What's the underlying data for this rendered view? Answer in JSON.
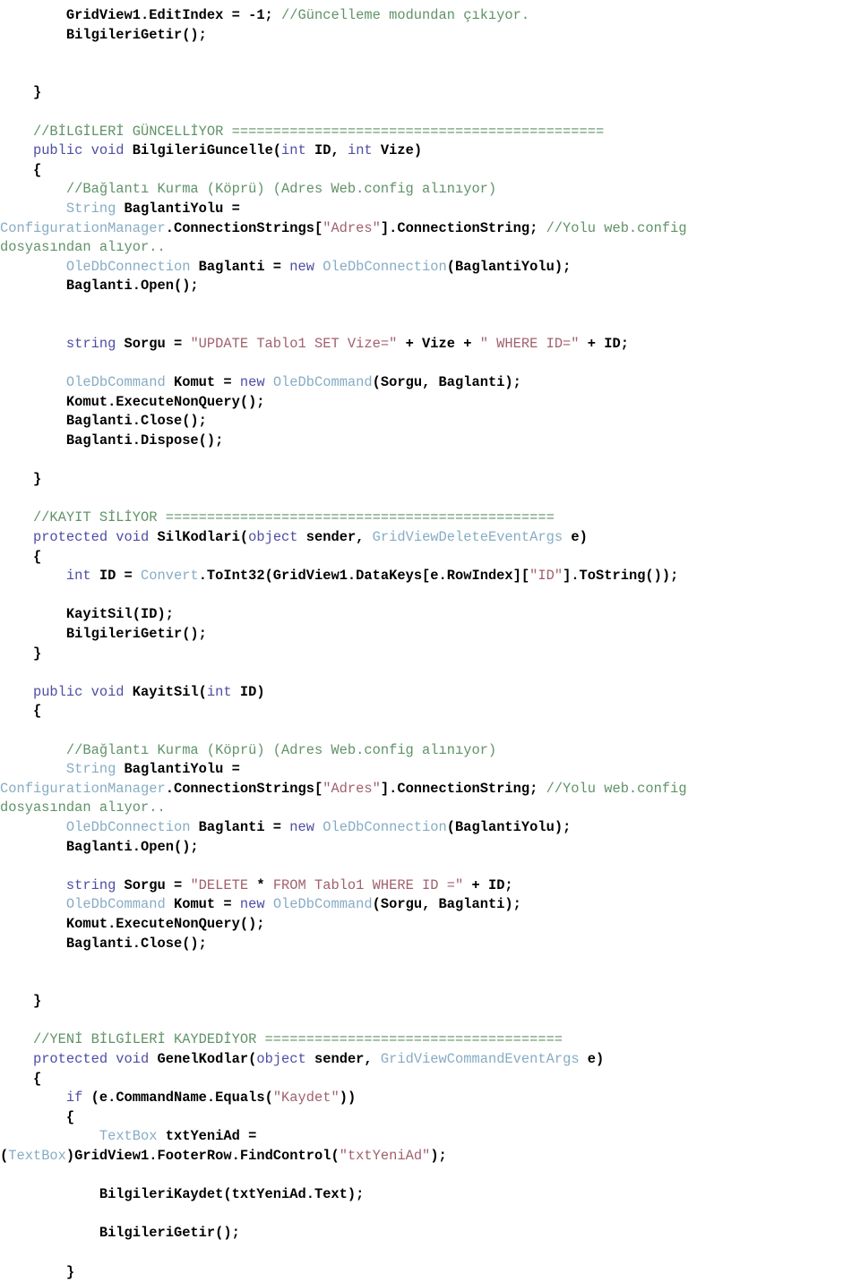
{
  "document": {
    "title": "C# ASP.NET GridView Kodlari",
    "language": "csharp",
    "background_color": "#ffffff"
  },
  "theme": {
    "plain": "#000000",
    "comment": "#5f9367",
    "keyword": "#4d4da6",
    "type": "#86acc4",
    "string": "#a1606d",
    "operator": "#000000"
  },
  "code": {
    "lines": [
      {
        "id": "l1",
        "tokens": [
          {
            "t": "        ",
            "c": "plain"
          },
          {
            "t": "GridView1.EditIndex = -1; ",
            "c": "plain"
          },
          {
            "t": "//Güncelleme modundan çıkıyor.",
            "c": "comment"
          }
        ]
      },
      {
        "id": "l2",
        "tokens": [
          {
            "t": "        BilgileriGetir();",
            "c": "plain"
          }
        ]
      },
      {
        "id": "l3",
        "tokens": []
      },
      {
        "id": "l4",
        "tokens": []
      },
      {
        "id": "l5",
        "tokens": [
          {
            "t": "    }",
            "c": "plain"
          }
        ]
      },
      {
        "id": "l6",
        "tokens": []
      },
      {
        "id": "l7",
        "tokens": [
          {
            "t": "    //BİLGİLERİ GÜNCELLİYOR =============================================",
            "c": "comment"
          }
        ]
      },
      {
        "id": "l8",
        "tokens": [
          {
            "t": "    ",
            "c": "plain"
          },
          {
            "t": "public void ",
            "c": "keyword"
          },
          {
            "t": "BilgileriGuncelle(",
            "c": "plain"
          },
          {
            "t": "int ",
            "c": "keyword"
          },
          {
            "t": "ID, ",
            "c": "plain"
          },
          {
            "t": "int ",
            "c": "keyword"
          },
          {
            "t": "Vize)",
            "c": "plain"
          }
        ]
      },
      {
        "id": "l9",
        "tokens": [
          {
            "t": "    {",
            "c": "plain"
          }
        ]
      },
      {
        "id": "l10",
        "tokens": [
          {
            "t": "        //Bağlantı Kurma (Köprü) (Adres Web.config alınıyor)",
            "c": "comment"
          }
        ]
      },
      {
        "id": "l11",
        "tokens": [
          {
            "t": "        ",
            "c": "plain"
          },
          {
            "t": "String ",
            "c": "type"
          },
          {
            "t": "BaglantiYolu =",
            "c": "plain"
          }
        ]
      },
      {
        "id": "l12",
        "tokens": [
          {
            "t": "ConfigurationManager",
            "c": "type"
          },
          {
            "t": ".ConnectionStrings[",
            "c": "plain"
          },
          {
            "t": "\"Adres\"",
            "c": "string"
          },
          {
            "t": "].ConnectionString; ",
            "c": "plain"
          },
          {
            "t": "//Yolu web.config",
            "c": "comment"
          }
        ]
      },
      {
        "id": "l13",
        "tokens": [
          {
            "t": "dosyasından alıyor..",
            "c": "comment"
          }
        ]
      },
      {
        "id": "l14",
        "tokens": [
          {
            "t": "        ",
            "c": "plain"
          },
          {
            "t": "OleDbConnection ",
            "c": "type"
          },
          {
            "t": "Baglanti = ",
            "c": "plain"
          },
          {
            "t": "new ",
            "c": "keyword"
          },
          {
            "t": "OleDbConnection",
            "c": "type"
          },
          {
            "t": "(BaglantiYolu);",
            "c": "plain"
          }
        ]
      },
      {
        "id": "l15",
        "tokens": [
          {
            "t": "        Baglanti.Open();",
            "c": "plain"
          }
        ]
      },
      {
        "id": "l16",
        "tokens": []
      },
      {
        "id": "l17",
        "tokens": []
      },
      {
        "id": "l18",
        "tokens": [
          {
            "t": "        ",
            "c": "plain"
          },
          {
            "t": "string ",
            "c": "keyword"
          },
          {
            "t": "Sorgu = ",
            "c": "plain"
          },
          {
            "t": "\"UPDATE Tablo1 SET Vize=\"",
            "c": "string"
          },
          {
            "t": " + Vize + ",
            "c": "plain"
          },
          {
            "t": "\" WHERE ID=\"",
            "c": "string"
          },
          {
            "t": " + ID;",
            "c": "plain"
          }
        ]
      },
      {
        "id": "l19",
        "tokens": []
      },
      {
        "id": "l20",
        "tokens": [
          {
            "t": "        ",
            "c": "plain"
          },
          {
            "t": "OleDbCommand ",
            "c": "type"
          },
          {
            "t": "Komut = ",
            "c": "plain"
          },
          {
            "t": "new ",
            "c": "keyword"
          },
          {
            "t": "OleDbCommand",
            "c": "type"
          },
          {
            "t": "(Sorgu, Baglanti);",
            "c": "plain"
          }
        ]
      },
      {
        "id": "l21",
        "tokens": [
          {
            "t": "        Komut.ExecuteNonQuery();",
            "c": "plain"
          }
        ]
      },
      {
        "id": "l22",
        "tokens": [
          {
            "t": "        Baglanti.Close();",
            "c": "plain"
          }
        ]
      },
      {
        "id": "l23",
        "tokens": [
          {
            "t": "        Baglanti.Dispose();",
            "c": "plain"
          }
        ]
      },
      {
        "id": "l24",
        "tokens": []
      },
      {
        "id": "l25",
        "tokens": [
          {
            "t": "    }",
            "c": "plain"
          }
        ]
      },
      {
        "id": "l26",
        "tokens": []
      },
      {
        "id": "l27",
        "tokens": [
          {
            "t": "    //KAYIT SİLİYOR ===============================================",
            "c": "comment"
          }
        ]
      },
      {
        "id": "l28",
        "tokens": [
          {
            "t": "    ",
            "c": "plain"
          },
          {
            "t": "protected void ",
            "c": "keyword"
          },
          {
            "t": "SilKodlari(",
            "c": "plain"
          },
          {
            "t": "object ",
            "c": "keyword"
          },
          {
            "t": "sender, ",
            "c": "plain"
          },
          {
            "t": "GridViewDeleteEventArgs ",
            "c": "type"
          },
          {
            "t": "e)",
            "c": "plain"
          }
        ]
      },
      {
        "id": "l29",
        "tokens": [
          {
            "t": "    {",
            "c": "plain"
          }
        ]
      },
      {
        "id": "l30",
        "tokens": [
          {
            "t": "        ",
            "c": "plain"
          },
          {
            "t": "int ",
            "c": "keyword"
          },
          {
            "t": "ID = ",
            "c": "plain"
          },
          {
            "t": "Convert",
            "c": "type"
          },
          {
            "t": ".ToInt32(GridView1.DataKeys[e.RowIndex][",
            "c": "plain"
          },
          {
            "t": "\"ID\"",
            "c": "string"
          },
          {
            "t": "].ToString());",
            "c": "plain"
          }
        ]
      },
      {
        "id": "l31",
        "tokens": []
      },
      {
        "id": "l32",
        "tokens": [
          {
            "t": "        KayitSil(ID);",
            "c": "plain"
          }
        ]
      },
      {
        "id": "l33",
        "tokens": [
          {
            "t": "        BilgileriGetir();",
            "c": "plain"
          }
        ]
      },
      {
        "id": "l34",
        "tokens": [
          {
            "t": "    }",
            "c": "plain"
          }
        ]
      },
      {
        "id": "l35",
        "tokens": []
      },
      {
        "id": "l36",
        "tokens": [
          {
            "t": "    ",
            "c": "plain"
          },
          {
            "t": "public void ",
            "c": "keyword"
          },
          {
            "t": "KayitSil(",
            "c": "plain"
          },
          {
            "t": "int ",
            "c": "keyword"
          },
          {
            "t": "ID)",
            "c": "plain"
          }
        ]
      },
      {
        "id": "l37",
        "tokens": [
          {
            "t": "    {",
            "c": "plain"
          }
        ]
      },
      {
        "id": "l38",
        "tokens": []
      },
      {
        "id": "l39",
        "tokens": [
          {
            "t": "        //Bağlantı Kurma (Köprü) (Adres Web.config alınıyor)",
            "c": "comment"
          }
        ]
      },
      {
        "id": "l40",
        "tokens": [
          {
            "t": "        ",
            "c": "plain"
          },
          {
            "t": "String ",
            "c": "type"
          },
          {
            "t": "BaglantiYolu =",
            "c": "plain"
          }
        ]
      },
      {
        "id": "l41",
        "tokens": [
          {
            "t": "ConfigurationManager",
            "c": "type"
          },
          {
            "t": ".ConnectionStrings[",
            "c": "plain"
          },
          {
            "t": "\"Adres\"",
            "c": "string"
          },
          {
            "t": "].ConnectionString; ",
            "c": "plain"
          },
          {
            "t": "//Yolu web.config",
            "c": "comment"
          }
        ]
      },
      {
        "id": "l42",
        "tokens": [
          {
            "t": "dosyasından alıyor..",
            "c": "comment"
          }
        ]
      },
      {
        "id": "l43",
        "tokens": [
          {
            "t": "        ",
            "c": "plain"
          },
          {
            "t": "OleDbConnection ",
            "c": "type"
          },
          {
            "t": "Baglanti = ",
            "c": "plain"
          },
          {
            "t": "new ",
            "c": "keyword"
          },
          {
            "t": "OleDbConnection",
            "c": "type"
          },
          {
            "t": "(BaglantiYolu);",
            "c": "plain"
          }
        ]
      },
      {
        "id": "l44",
        "tokens": [
          {
            "t": "        Baglanti.Open();",
            "c": "plain"
          }
        ]
      },
      {
        "id": "l45",
        "tokens": []
      },
      {
        "id": "l46",
        "tokens": [
          {
            "t": "        ",
            "c": "plain"
          },
          {
            "t": "string ",
            "c": "keyword"
          },
          {
            "t": "Sorgu = ",
            "c": "plain"
          },
          {
            "t": "\"DELETE ",
            "c": "string"
          },
          {
            "t": "*",
            "c": "plain"
          },
          {
            "t": " FROM Tablo1 WHERE ID =\"",
            "c": "string"
          },
          {
            "t": " + ID;",
            "c": "plain"
          }
        ]
      },
      {
        "id": "l47",
        "tokens": [
          {
            "t": "        ",
            "c": "plain"
          },
          {
            "t": "OleDbCommand ",
            "c": "type"
          },
          {
            "t": "Komut = ",
            "c": "plain"
          },
          {
            "t": "new ",
            "c": "keyword"
          },
          {
            "t": "OleDbCommand",
            "c": "type"
          },
          {
            "t": "(Sorgu, Baglanti);",
            "c": "plain"
          }
        ]
      },
      {
        "id": "l48",
        "tokens": [
          {
            "t": "        Komut.ExecuteNonQuery();",
            "c": "plain"
          }
        ]
      },
      {
        "id": "l49",
        "tokens": [
          {
            "t": "        Baglanti.Close();",
            "c": "plain"
          }
        ]
      },
      {
        "id": "l50",
        "tokens": []
      },
      {
        "id": "l51",
        "tokens": []
      },
      {
        "id": "l52",
        "tokens": [
          {
            "t": "    }",
            "c": "plain"
          }
        ]
      },
      {
        "id": "l53",
        "tokens": []
      },
      {
        "id": "l54",
        "tokens": [
          {
            "t": "    //YENİ BİLGİLERİ KAYDEDİYOR ====================================",
            "c": "comment"
          }
        ]
      },
      {
        "id": "l55",
        "tokens": [
          {
            "t": "    ",
            "c": "plain"
          },
          {
            "t": "protected void ",
            "c": "keyword"
          },
          {
            "t": "GenelKodlar(",
            "c": "plain"
          },
          {
            "t": "object ",
            "c": "keyword"
          },
          {
            "t": "sender, ",
            "c": "plain"
          },
          {
            "t": "GridViewCommandEventArgs ",
            "c": "type"
          },
          {
            "t": "e)",
            "c": "plain"
          }
        ]
      },
      {
        "id": "l56",
        "tokens": [
          {
            "t": "    {",
            "c": "plain"
          }
        ]
      },
      {
        "id": "l57",
        "tokens": [
          {
            "t": "        ",
            "c": "plain"
          },
          {
            "t": "if ",
            "c": "keyword"
          },
          {
            "t": "(e.CommandName.Equals(",
            "c": "plain"
          },
          {
            "t": "\"Kaydet\"",
            "c": "string"
          },
          {
            "t": "))",
            "c": "plain"
          }
        ]
      },
      {
        "id": "l58",
        "tokens": [
          {
            "t": "        {",
            "c": "plain"
          }
        ]
      },
      {
        "id": "l59",
        "tokens": [
          {
            "t": "            ",
            "c": "plain"
          },
          {
            "t": "TextBox ",
            "c": "type"
          },
          {
            "t": "txtYeniAd =",
            "c": "plain"
          }
        ]
      },
      {
        "id": "l60",
        "tokens": [
          {
            "t": "(",
            "c": "plain"
          },
          {
            "t": "TextBox",
            "c": "type"
          },
          {
            "t": ")GridView1.FooterRow.FindControl(",
            "c": "plain"
          },
          {
            "t": "\"txtYeniAd\"",
            "c": "string"
          },
          {
            "t": ");",
            "c": "plain"
          }
        ]
      },
      {
        "id": "l61",
        "tokens": []
      },
      {
        "id": "l62",
        "tokens": [
          {
            "t": "            BilgileriKaydet(txtYeniAd.Text);",
            "c": "plain"
          }
        ]
      },
      {
        "id": "l63",
        "tokens": []
      },
      {
        "id": "l64",
        "tokens": [
          {
            "t": "            BilgileriGetir();",
            "c": "plain"
          }
        ]
      },
      {
        "id": "l65",
        "tokens": []
      },
      {
        "id": "l66",
        "tokens": [
          {
            "t": "        }",
            "c": "plain"
          }
        ]
      }
    ]
  }
}
